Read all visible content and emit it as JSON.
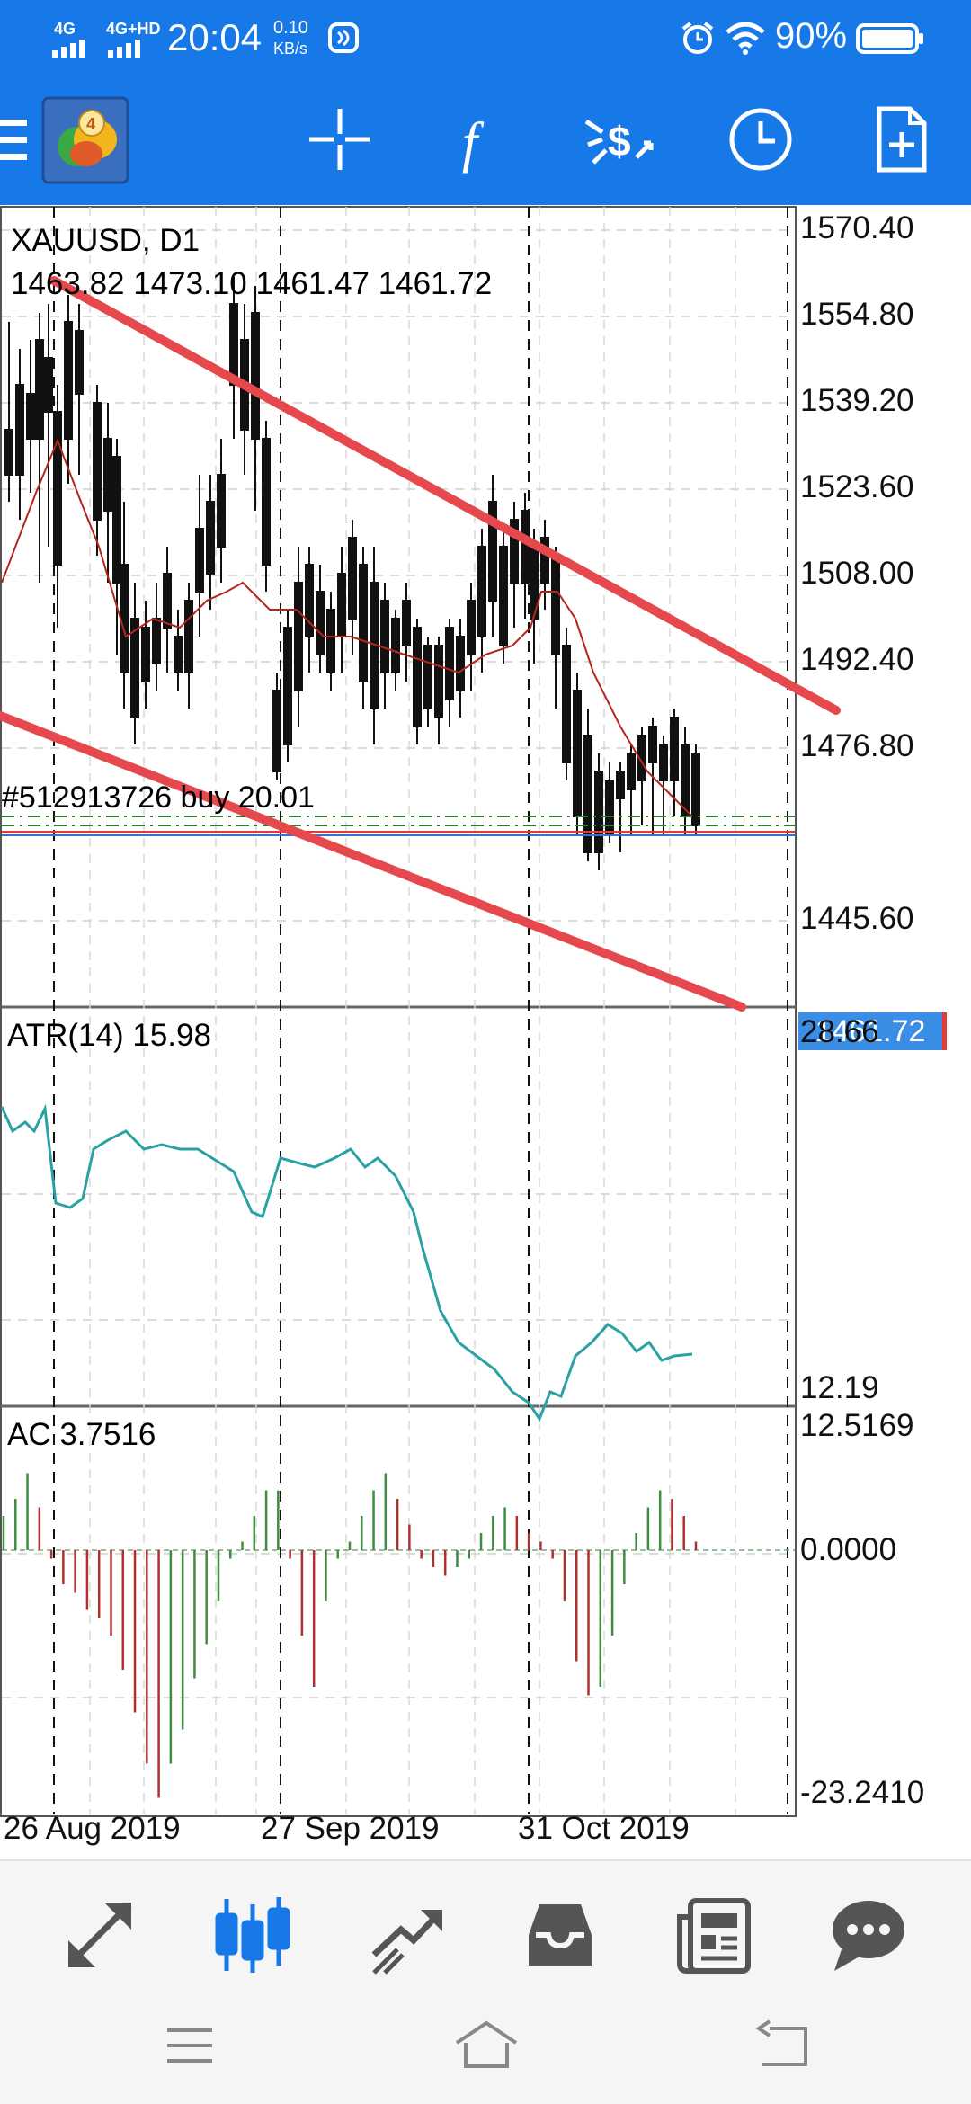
{
  "status_bar": {
    "network_1": "4G",
    "network_2": "4G+HD",
    "time": "20:04",
    "speed_value": "0.10",
    "speed_unit": "KB/s",
    "battery_percent": "90%",
    "icons": [
      "signal-icon",
      "nfc-icon",
      "alarm-icon",
      "wifi-icon",
      "battery-icon"
    ]
  },
  "toolbar": {
    "icons": [
      "menu-icon",
      "metatrader-logo-icon",
      "crosshair-icon",
      "indicators-icon",
      "objects-icon",
      "timeframe-clock-icon",
      "new-document-icon"
    ],
    "accent_color": "#1778e8"
  },
  "chart": {
    "symbol_timeframe": "XAUUSD, D1",
    "ohlc": "1463.82 1473.10 1461.47 1461.72",
    "order_label": "#512913726 buy 20.01",
    "current_price": "1461.72",
    "price_axis": [
      "1570.40",
      "1554.80",
      "1539.20",
      "1523.60",
      "1508.00",
      "1492.40",
      "1476.80",
      "1445.60"
    ],
    "atr_label": "ATR(14) 15.98",
    "atr_axis": [
      "28.66",
      "12.19"
    ],
    "ac_label": "AC 3.7516",
    "ac_axis": [
      "12.5169",
      "0.0000",
      "-23.2410"
    ],
    "dates": [
      "26 Aug 2019",
      "27 Sep 2019",
      "31 Oct 2019"
    ],
    "colors": {
      "trendline": "#e5484d",
      "ma": "#b3261e",
      "atr": "#2aa1a3",
      "ac_up": "#3d8c40",
      "ac_down": "#b03030"
    }
  },
  "bottom_nav": {
    "icons": [
      "quotes-icon",
      "chart-icon",
      "trade-icon",
      "history-icon",
      "news-icon",
      "messages-icon"
    ],
    "active": "chart-icon",
    "system_icons": [
      "recent-apps-icon",
      "home-icon",
      "back-icon"
    ]
  }
}
